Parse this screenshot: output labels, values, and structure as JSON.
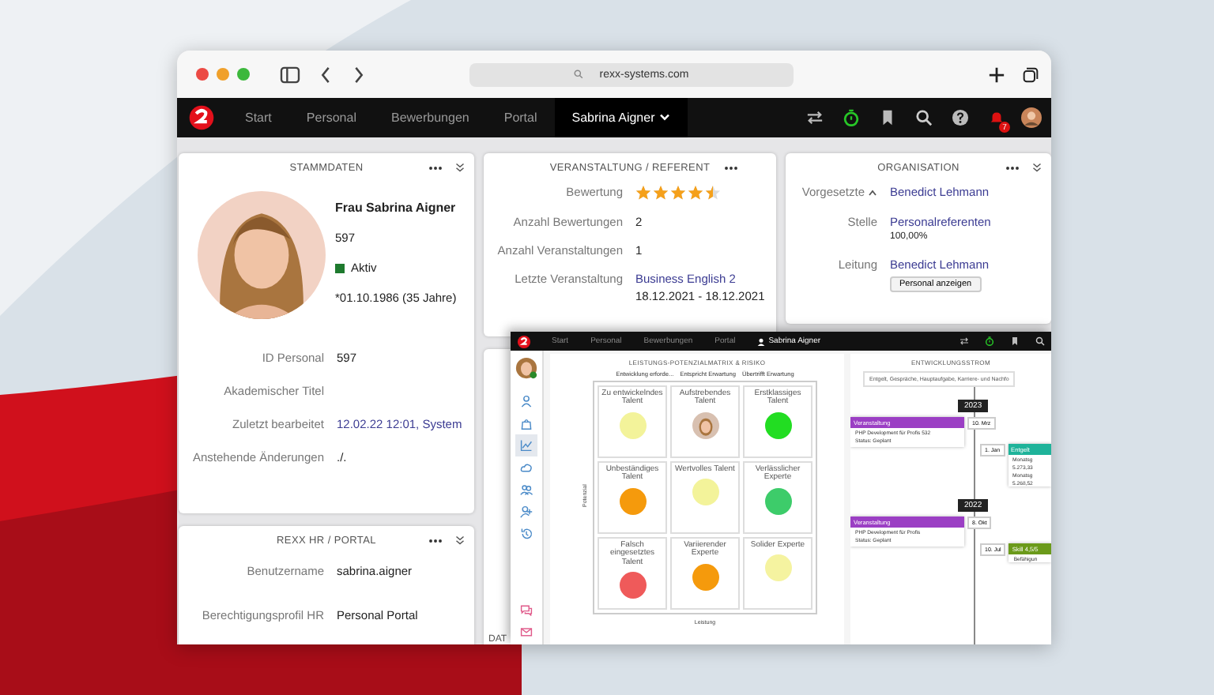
{
  "browser": {
    "url": "rexx-systems.com"
  },
  "nav": {
    "items": [
      {
        "label": "Start",
        "selected": false
      },
      {
        "label": "Personal",
        "selected": false
      },
      {
        "label": "Bewerbungen",
        "selected": false
      },
      {
        "label": "Portal",
        "selected": false
      },
      {
        "label": "Sabrina Aigner",
        "selected": true
      }
    ],
    "badge": "7"
  },
  "stammdaten": {
    "title": "STAMMDATEN",
    "name": "Frau Sabrina Aigner",
    "id": "597",
    "status": "Aktiv",
    "birth": "*01.10.1986 (35 Jahre)",
    "rows": [
      {
        "label": "ID Personal",
        "value": "597",
        "kind": "text"
      },
      {
        "label": "Akademischer Titel",
        "kind": "text"
      },
      {
        "label": "Zuletzt bearbeitet",
        "value": "12.02.22 12:01, System",
        "kind": "link"
      },
      {
        "label": "Anstehende Änderungen",
        "value": "./.",
        "kind": "text"
      }
    ]
  },
  "portal": {
    "title": "REXX HR / PORTAL",
    "rows": [
      {
        "label": "Benutzername",
        "value": "sabrina.aigner",
        "kind": "text"
      },
      {
        "label": "Berechtigungsprofil HR",
        "value": "Personal Portal",
        "kind": "text"
      }
    ]
  },
  "veranstaltung": {
    "title": "VERANSTALTUNG / REFERENT",
    "rows": [
      {
        "label": "Bewertung",
        "kind": "stars",
        "stars": 4.5
      },
      {
        "label": "Anzahl Bewertungen",
        "value": "2",
        "kind": "text"
      },
      {
        "label": "Anzahl Veranstaltungen",
        "value": "1",
        "kind": "text"
      },
      {
        "label": "Letzte Veranstaltung",
        "value": "Business English 2",
        "kind": "link",
        "sub": "18.12.2021 - 18.12.2021"
      }
    ]
  },
  "organisation": {
    "title": "ORGANISATION",
    "rows": [
      {
        "label": "Vorgesetzte",
        "value": "Benedict Lehmann",
        "kind": "link",
        "caret": true
      },
      {
        "label": "Stelle",
        "value": "Personalreferenten",
        "kind": "link",
        "sub": "100,00%"
      },
      {
        "label": "Leitung",
        "value": "Benedict Lehmann",
        "kind": "link",
        "button": "Personal anzeigen"
      }
    ]
  },
  "hidden_card": {
    "text": "DAT"
  },
  "inset": {
    "nav": [
      {
        "label": "Start",
        "selected": false
      },
      {
        "label": "Personal",
        "selected": false
      },
      {
        "label": "Bewerbungen",
        "selected": false
      },
      {
        "label": "Portal",
        "selected": false
      },
      {
        "label": "Sabrina Aigner",
        "selected": true
      }
    ],
    "matrix": {
      "title": "LEISTUNGS-POTENZIALMATRIX & RISIKO",
      "columns": [
        "Entwicklung erforde...",
        "Entspricht Erwartung",
        "Übertrifft Erwartung"
      ],
      "ylabel": "Potenzial",
      "xlabel": "Leistung",
      "cells": [
        {
          "label": "Zu entwickelndes Talent",
          "kind": "dot",
          "color": "#f3f39a"
        },
        {
          "label": "Aufstrebendes Talent"
        },
        {
          "label": "Erstklassiges Talent",
          "kind": "dot",
          "color": "#22dd22"
        },
        {
          "label": "Unbeständiges Talent",
          "kind": "dot",
          "color": "#f59a0c"
        },
        {
          "label": "Wertvolles Talent",
          "kind": "dot",
          "color": "#f3f39a"
        },
        {
          "label": "Verlässlicher Experte",
          "kind": "dot",
          "color": "#3dcc6a"
        },
        {
          "label": "Falsch eingesetztes Talent",
          "kind": "dot",
          "color": "#ef5a5a"
        },
        {
          "label": "Variierender Experte",
          "kind": "dot",
          "color": "#f59a0c"
        },
        {
          "label": "Solider Experte",
          "kind": "dot",
          "color": "#f5f3a0"
        }
      ]
    },
    "stream": {
      "title": "ENTWICKLUNGSSTROM",
      "filter": "Entgelt, Gespräche, Hauptaufgabe, Karriere- und Nachfo",
      "years": [
        {
          "year": "2023",
          "events": [
            {
              "tag": "Veranstaltung",
              "date": "10. Mrz",
              "lines": [
                "PHP Development für Profis 532",
                "Status: Geplant"
              ],
              "color": "#9b3fc4"
            }
          ],
          "side": {
            "tag": "Entgelt",
            "date": "1. Jan",
            "lines": [
              "Monatsg",
              "5.273,33",
              "Monatsg",
              "5.268,52"
            ],
            "color": "#1fb39a"
          }
        },
        {
          "year": "2022",
          "events": [
            {
              "tag": "Veranstaltung",
              "date": "8. Okt",
              "lines": [
                "PHP Development für Profis",
                "Status: Geplant"
              ],
              "color": "#9b3fc4"
            }
          ],
          "side": {
            "tag": "Skill 4,5/5",
            "date": "10. Jul",
            "lines": [
              "Befähigun"
            ],
            "color": "#6b9a1a"
          }
        }
      ]
    }
  }
}
